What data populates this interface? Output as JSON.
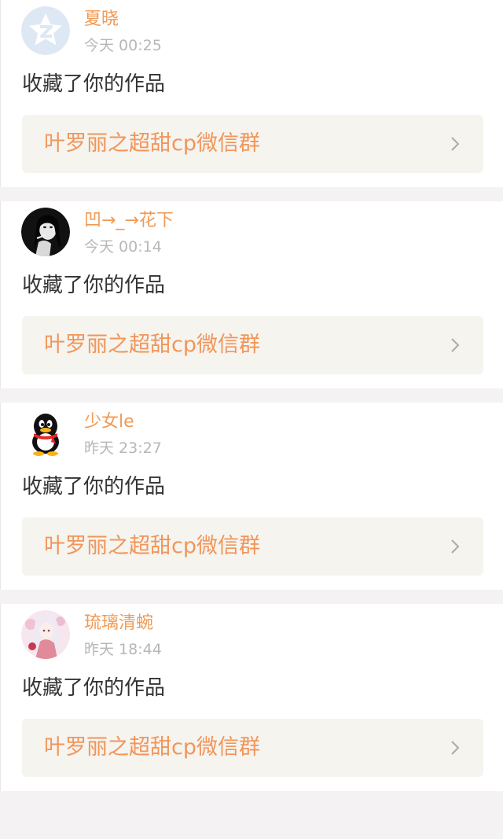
{
  "notifications": [
    {
      "user": "夏晓",
      "time": "今天 00:25",
      "action": "收藏了你的作品",
      "work_title": "叶罗丽之超甜cp微信群",
      "avatar_icon": "default-star-avatar-icon"
    },
    {
      "user": "凹→_→花下",
      "time": "今天 00:14",
      "action": "收藏了你的作品",
      "work_title": "叶罗丽之超甜cp微信群",
      "avatar_icon": "bw-portrait-avatar-icon"
    },
    {
      "user": "少女le",
      "time": "昨天 23:27",
      "action": "收藏了你的作品",
      "work_title": "叶罗丽之超甜cp微信群",
      "avatar_icon": "qq-penguin-avatar-icon"
    },
    {
      "user": "琉璃清蜿",
      "time": "昨天 18:44",
      "action": "收藏了你的作品",
      "work_title": "叶罗丽之超甜cp微信群",
      "avatar_icon": "anime-girl-avatar-icon"
    }
  ],
  "colors": {
    "username": "#f09a55",
    "link_text": "#f2955a",
    "link_bg": "#f5f4ef",
    "timestamp": "#b7b7b7",
    "divider": "#f4f2f2"
  }
}
